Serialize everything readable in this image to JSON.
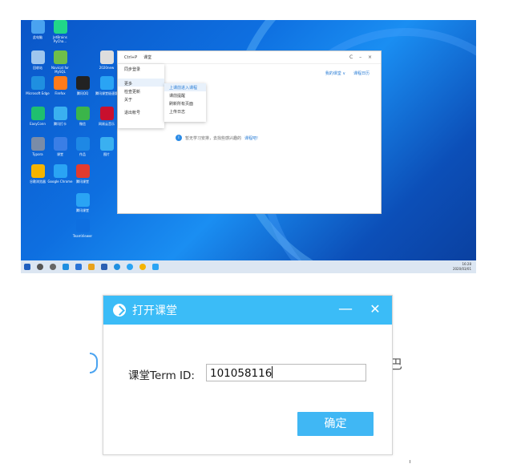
{
  "desktop": {
    "icons": [
      {
        "label": "此电脑",
        "color": "#4aa3f0"
      },
      {
        "label": "JetBrains PyCha...",
        "color": "#21d789"
      },
      {
        "label": "回收站",
        "color": "#9fc6ee"
      },
      {
        "label": "Navicat for MySQL",
        "color": "#6fbf4a"
      },
      {
        "label": "2020new",
        "color": "#dddddd"
      },
      {
        "label": "Microsoft Edge",
        "color": "#1f8fe0"
      },
      {
        "label": "Firefox",
        "color": "#ff7b1a"
      },
      {
        "label": "腾讯QQ",
        "color": "#222222"
      },
      {
        "label": "腾讯课堂极速版",
        "color": "#2aa4f4"
      },
      {
        "label": "EasyConn",
        "color": "#1fbf6f"
      },
      {
        "label": "腾讯打卡",
        "color": "#3ab0f0"
      },
      {
        "label": "微信",
        "color": "#3bb54a"
      },
      {
        "label": "网易云音乐",
        "color": "#c8102e"
      },
      {
        "label": "Typora",
        "color": "#7a8ca8"
      },
      {
        "label": "课堂",
        "color": "#3a7ee6"
      },
      {
        "label": "作品",
        "color": "#1e88e5"
      },
      {
        "label": "图片",
        "color": "#3ab0f0"
      },
      {
        "label": "谷歌浏览器",
        "color": "#f4b400"
      },
      {
        "label": "Google Chrome",
        "color": "#2aa4f4"
      },
      {
        "label": "腾讯课堂",
        "color": "#e33b2e"
      },
      {
        "label": "腾讯课堂",
        "color": "#2aa4f4"
      },
      {
        "label": "TeamViewer",
        "color": "#0e6fe0"
      }
    ],
    "app": {
      "tabs": [
        "Ctrl+P",
        "课堂"
      ],
      "win_controls": "C – ×",
      "tool_links": [
        "我的课堂 ∨",
        "课程日历"
      ],
      "menu": {
        "items": [
          "同步登录",
          "",
          "更多",
          "检查更新",
          "关于",
          "",
          "退出帐号"
        ],
        "submenu": [
          "上课前进入课程",
          "课前提醒",
          "刷新所有页面",
          "上传日志"
        ]
      },
      "empty_text": "暂无学习安排，去找些感兴趣的",
      "empty_link": "课程吧!"
    },
    "tray": {
      "time": "16:28",
      "date": "2020/03/01"
    }
  },
  "dialog": {
    "title": "打开课堂",
    "minimize": "—",
    "close": "✕",
    "field_label": "课堂Term ID:",
    "field_value": "101058116",
    "ok_label": "确定"
  },
  "behind": {
    "right_glyph": "巴"
  }
}
